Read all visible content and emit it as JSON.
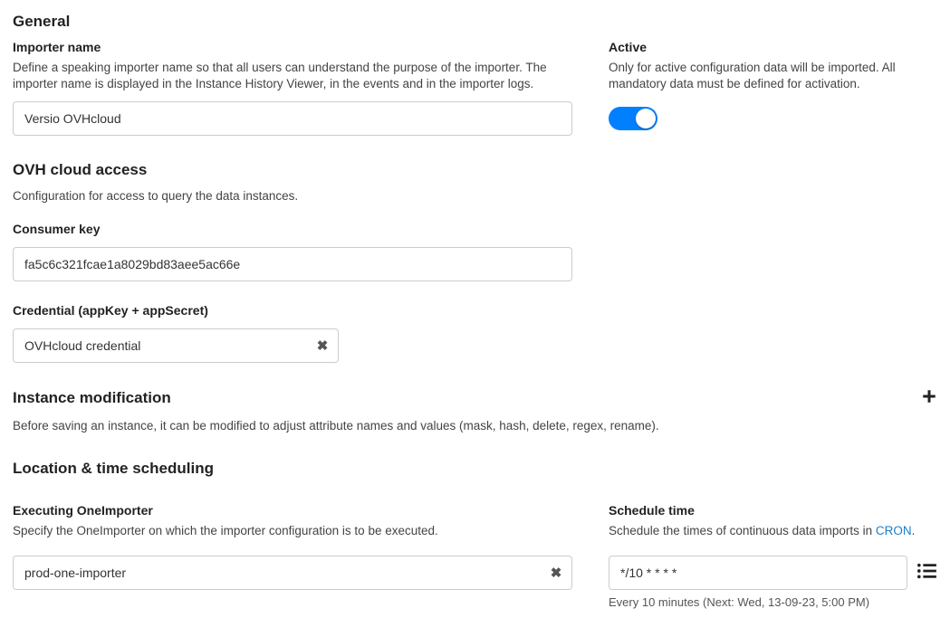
{
  "sections": {
    "general": {
      "heading": "General",
      "importer_name": {
        "label": "Importer name",
        "help": "Define a speaking importer name so that all users can understand the purpose of the importer. The importer name is displayed in the Instance History Viewer, in the events and in the importer logs.",
        "value": "Versio OVHcloud"
      },
      "active": {
        "label": "Active",
        "help": "Only for active configuration data will be imported. All mandatory data must be defined for activation.",
        "value": true
      }
    },
    "ovh": {
      "heading": "OVH cloud access",
      "desc": "Configuration for access to query the data instances.",
      "consumer_key": {
        "label": "Consumer key",
        "value": "fa5c6c321fcae1a8029bd83aee5ac66e"
      },
      "credential": {
        "label": "Credential (appKey + appSecret)",
        "value": "OVHcloud credential"
      }
    },
    "instance_mod": {
      "heading": "Instance modification",
      "desc": "Before saving an instance, it can be modified to adjust attribute names and values (mask, hash, delete, regex, rename)."
    },
    "location": {
      "heading": "Location & time scheduling",
      "executing": {
        "label": "Executing OneImporter",
        "help": "Specify the OneImporter on which the importer configuration is to be executed.",
        "value": "prod-one-importer"
      },
      "schedule": {
        "label": "Schedule time",
        "help_prefix": "Schedule the times of continuous data imports in ",
        "help_link_text": "CRON",
        "help_suffix": ".",
        "value": "*/10 * * * *",
        "hint": "Every 10 minutes (Next: Wed, 13-09-23, 5:00 PM)"
      }
    }
  }
}
